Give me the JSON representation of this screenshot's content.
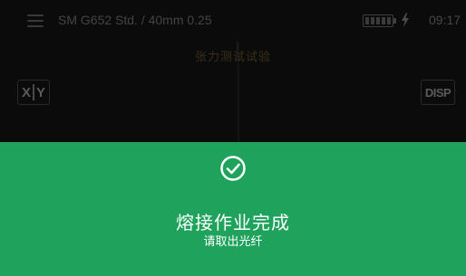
{
  "header": {
    "title": "SM G652 Std. / 40mm 0.25",
    "clock": "09:17",
    "charging_symbol": "ϟ",
    "battery_level": 1.0
  },
  "mode_text": "张力测试试验",
  "buttons": {
    "xy_left": "X",
    "xy_right": "Y",
    "disp": "DISP"
  },
  "completion": {
    "title": "熔接作业完成",
    "subtitle": "请取出光纤",
    "icon": "check-circle-icon"
  },
  "colors": {
    "panel_green": "#1fa35c",
    "background": "#0b0b0b"
  }
}
